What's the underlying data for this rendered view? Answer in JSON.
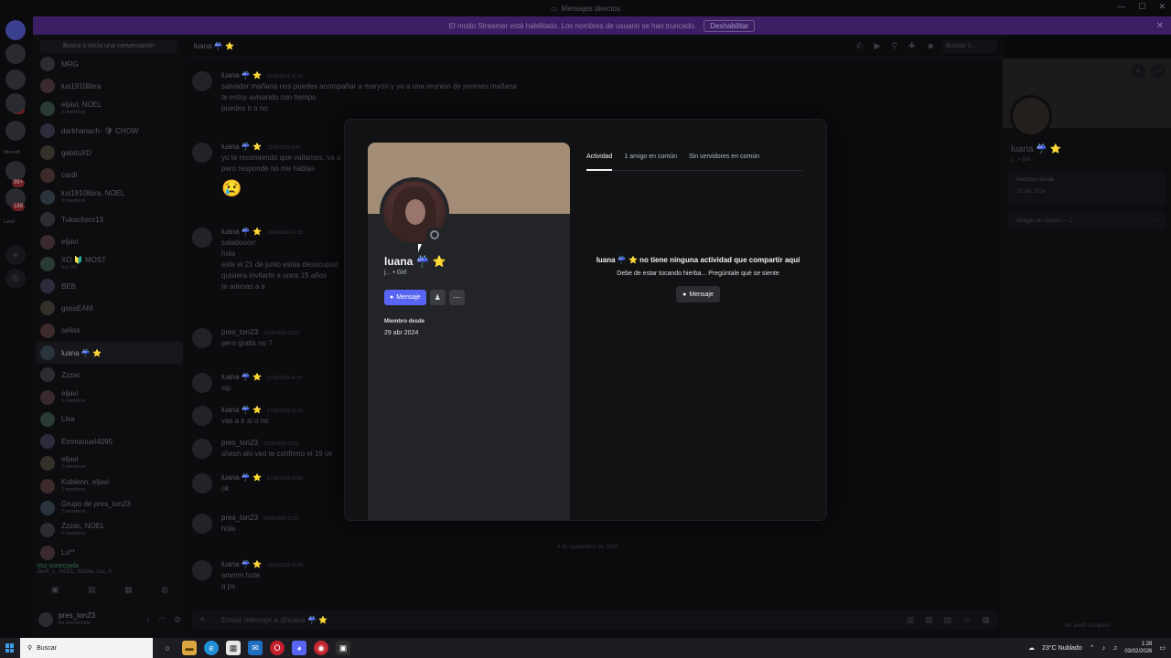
{
  "window": {
    "title": "Mensajes directos",
    "controls": [
      "—",
      "☐",
      "✕"
    ]
  },
  "banner": {
    "text": "El modo Streamer está habilitado. Los nombres de usuario se han truncado.",
    "button": "Deshabilitar",
    "close": "✕"
  },
  "rail": {
    "labels": [
      "Mineraft",
      "Lucid"
    ],
    "badges": [
      "184",
      "99+",
      "188"
    ]
  },
  "dm_sidebar": {
    "search_placeholder": "Busca o inicia una conversación",
    "items": [
      {
        "name": "MRG",
        "sub": ""
      },
      {
        "name": "lus1910libra",
        "sub": ""
      },
      {
        "name": "eljavi, NOEL",
        "sub": "3 miembros"
      },
      {
        "name": "darkhanach- 🛡 CHOW",
        "sub": ""
      },
      {
        "name": "gabitoXD",
        "sub": ""
      },
      {
        "name": "cardi",
        "sub": ""
      },
      {
        "name": "lus1910libra, NOEL",
        "sub": "3 miembros"
      },
      {
        "name": "Tukachecr13",
        "sub": ""
      },
      {
        "name": "eljavi",
        "sub": ""
      },
      {
        "name": "XO 🔰 MOST",
        "sub": "Soy XO"
      },
      {
        "name": "BEB",
        "sub": ""
      },
      {
        "name": "gossEAM",
        "sub": ""
      },
      {
        "name": "selias",
        "sub": ""
      },
      {
        "name": "luana ☔ ⭐",
        "sub": ""
      },
      {
        "name": "Zzzac",
        "sub": ""
      },
      {
        "name": "eljavi",
        "sub": "3 miembros"
      },
      {
        "name": "Lisa",
        "sub": ""
      },
      {
        "name": "Emmanuel4095",
        "sub": ""
      },
      {
        "name": "eljavi",
        "sub": "3 miembros"
      },
      {
        "name": "Koblenn, eljavi",
        "sub": "3 miembros"
      },
      {
        "name": "Grupo de pres_ton23",
        "sub": "2 miembros"
      },
      {
        "name": "Zzzac, NOEL",
        "sub": "3 miembros"
      },
      {
        "name": "Lu**",
        "sub": ""
      }
    ],
    "voice_title": "Voz conectada",
    "voice_sub": "Javifi_s...NOEL, Noche, Luc, 0",
    "user_name": "pres_ton23",
    "user_status": "En una llamada"
  },
  "chat": {
    "header_title": "luana ☔ ⭐",
    "search_placeholder": "Buscar 1...",
    "messages": [
      {
        "author": "luana ☔ ⭐",
        "time": "11/06/2024 22:13",
        "lines": [
          "salvador mañana nos puedes acompañar a maryori y yo a una reunion de jovenes mañana",
          "te estoy avisando con tiempo",
          "puedes ir o no"
        ]
      },
      {
        "author": "luana ☔ ⭐",
        "time": "12/06/2024 9:44",
        "lines": [
          "yo te recomiendo que vallamos. va a",
          "pero responde no me hablas",
          "😢"
        ]
      },
      {
        "author": "luana ☔ ⭐",
        "time": "16/06/2024 17:33",
        "lines": [
          "saladooorr",
          "hola",
          "este el 21 de junio estas desocupad",
          "quisiera invitarte a unos 15 años",
          "te animas a ir"
        ]
      },
      {
        "author": "pres_ton23",
        "time": "16/06/2024 22:52",
        "lines": [
          "pero gratis   no ?"
        ]
      },
      {
        "author": "luana ☔ ⭐",
        "time": "17/06/2024 16:53",
        "lines": [
          "sip"
        ]
      },
      {
        "author": "luana ☔ ⭐",
        "time": "17/06/2024 16:20",
        "lines": [
          "vas a ir si o no"
        ]
      },
      {
        "author": "pres_ton23",
        "time": "17/06/2024 18:01",
        "lines": [
          "shesh ahi veo te confirmo el 19 ok"
        ]
      },
      {
        "author": "luana ☔ ⭐",
        "time": "17/06/2024 18:09",
        "lines": [
          "ok"
        ]
      },
      {
        "author": "pres_ton23",
        "time": "29/06/2024 21:51",
        "lines": [
          "hola"
        ]
      },
      {
        "author": "luana ☔ ⭐",
        "time": "30/06/2024 10:09",
        "lines": [
          "ammm hola",
          "q ps"
        ]
      }
    ],
    "date_separator": "4 de septiembre de 2024",
    "composer_placeholder": "Enviar mensaje a @luana ☔ ⭐"
  },
  "right_panel": {
    "name": "luana ☔ ⭐",
    "sub": "j... • Girl",
    "member_since_label": "Miembro desde",
    "member_since": "29 abr 2024",
    "mutual_friends": "Amigos en común — 1",
    "footer": "Ver perfil completo"
  },
  "modal": {
    "profile": {
      "display_name": "luana ☔",
      "star": "⭐",
      "subtitle": "j... • Girl",
      "message_button": "Mensaje",
      "member_since_label": "Miembro desde",
      "member_since": "29 abr 2024"
    },
    "tabs": [
      "Actividad",
      "1 amigo en común",
      "Sin servidores en común"
    ],
    "empty": {
      "title": "luana ☔ ⭐ no tiene ninguna actividad que compartir aquí",
      "desc": "Debe de estar tocando hierba... Pregúntale qué se siente",
      "button": "Mensaje"
    }
  },
  "taskbar": {
    "search_placeholder": "Buscar",
    "weather": "23°C  Nublado",
    "time": "1:28",
    "date": "03/02/2026"
  },
  "colors": {
    "accent": "#5865f2",
    "banner_profile": "#a38d76",
    "streamer_banner": "#3b1e63"
  }
}
